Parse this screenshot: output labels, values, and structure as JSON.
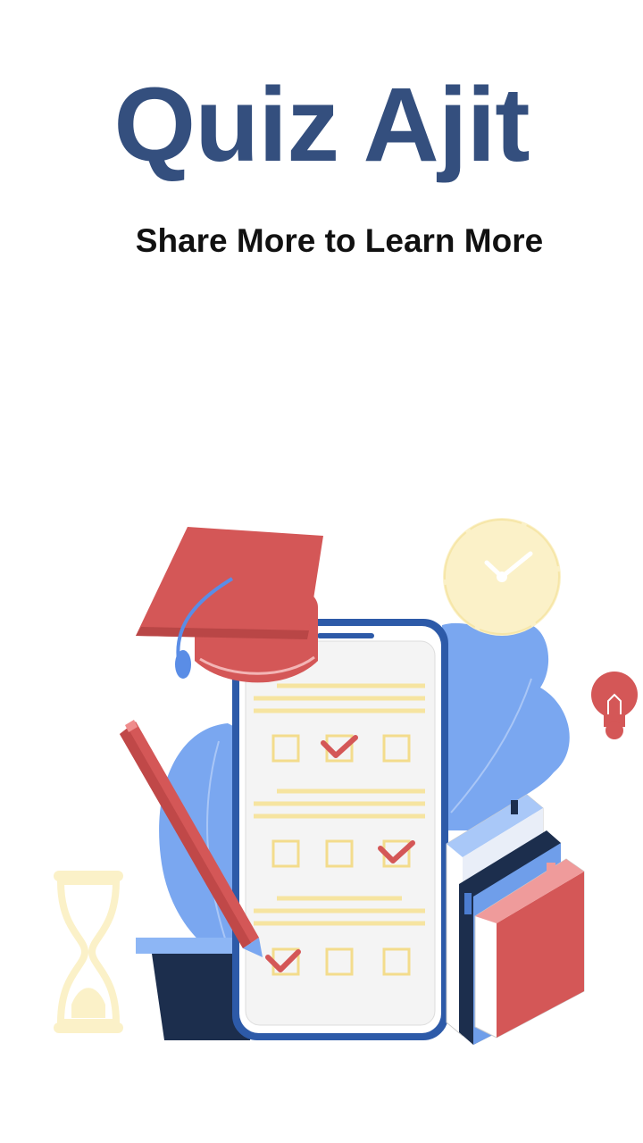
{
  "app": {
    "title": "Quiz Ajit",
    "tagline": "Share More to Learn More"
  },
  "colors": {
    "title": "#344f7e",
    "tagline": "#111111",
    "red": "#d45757",
    "blue": "#7aa7f0",
    "navy": "#1c2e4d",
    "cream": "#fbf1c8",
    "background": "#ffffff"
  },
  "illustration": {
    "quiz_rows": [
      {
        "checked_index": 1
      },
      {
        "checked_index": 2
      },
      {
        "checked_index": 0
      }
    ]
  }
}
